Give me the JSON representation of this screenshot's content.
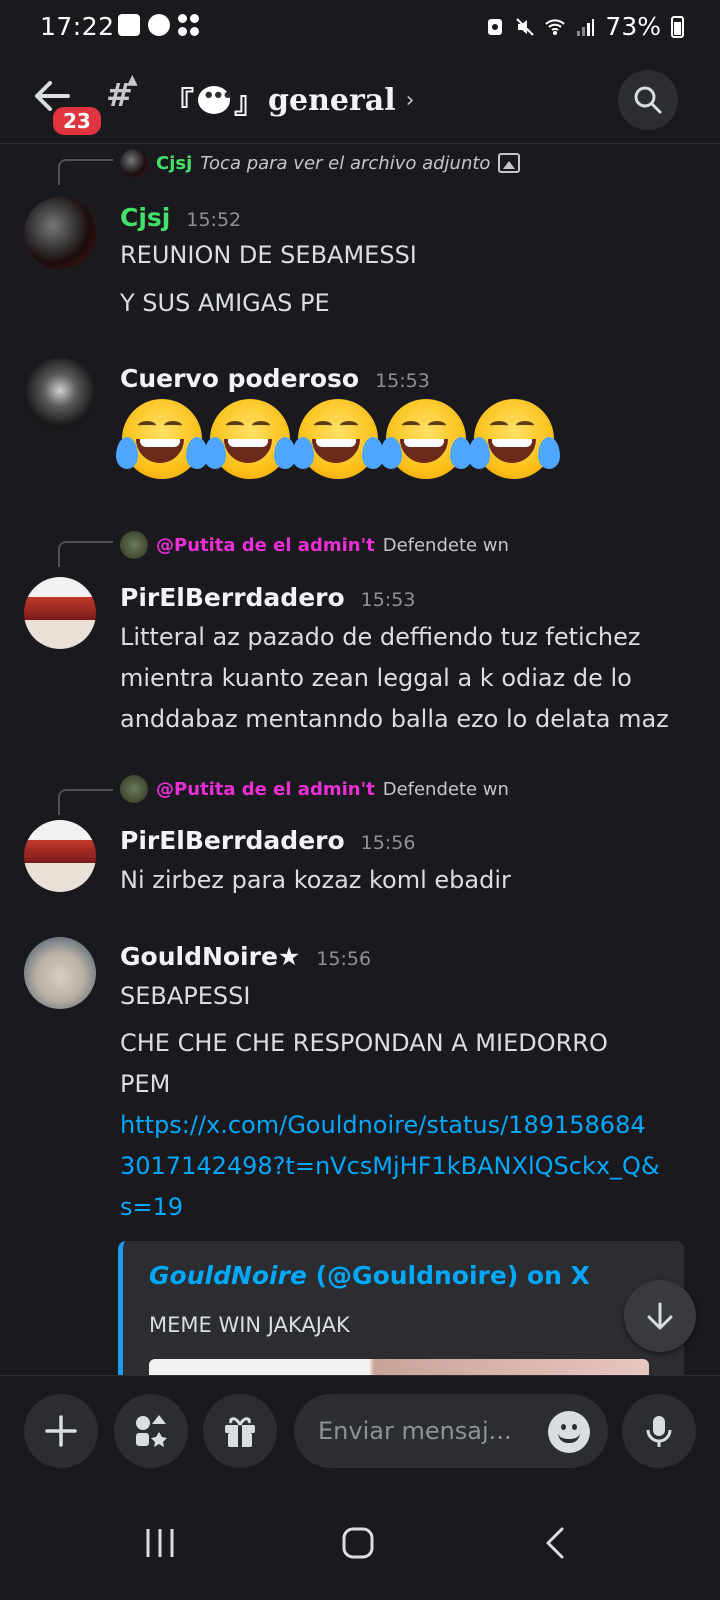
{
  "status_bar": {
    "time": "17:22",
    "battery": "73%"
  },
  "header": {
    "back_badge": "23",
    "channel_name": "general",
    "title_left_bracket": "『",
    "title_right_bracket": "』",
    "chevron": "›"
  },
  "messages": [
    {
      "reply": {
        "author": "Cjsj",
        "text": "Toca para ver el archivo adjunto",
        "author_color": "#3ba55d"
      },
      "author": "Cjsj",
      "author_color": "#43e06a",
      "time": "15:52",
      "lines": [
        "REUNION DE SEBAMESSI",
        "Y SUS AMIGAS PE"
      ]
    },
    {
      "author": "Cuervo poderoso",
      "author_color": "#f2f3f5",
      "time": "15:53",
      "emoji": [
        "face-with-tears-of-joy",
        "face-with-tears-of-joy",
        "face-with-tears-of-joy",
        "face-with-tears-of-joy",
        "face-with-tears-of-joy"
      ]
    },
    {
      "reply": {
        "author": "@Putita de el admin't",
        "text": "Defendete wn",
        "author_color": "#eb2fd6"
      },
      "author": "PirElBerrdadero",
      "author_color": "#f2f3f5",
      "time": "15:53",
      "lines": [
        "Litteral az pazado de deffiendo tuz fetichez",
        "mientra kuanto zean leggal   a k odiaz de lo",
        "anddabaz mentanndo balla ezo lo delata maz"
      ]
    },
    {
      "reply": {
        "author": "@Putita de el admin't",
        "text": "Defendete wn",
        "author_color": "#eb2fd6"
      },
      "author": "PirElBerrdadero",
      "author_color": "#f2f3f5",
      "time": "15:56",
      "lines": [
        "Ni zirbez para kozaz koml ebadir"
      ]
    },
    {
      "author": "GouldNoire★",
      "author_color": "#f2f3f5",
      "time": "15:56",
      "lines": [
        "SEBAPESSI",
        "CHE CHE CHE RESPONDAN A MIEDORRO",
        "PEM"
      ],
      "link_lines": [
        "https://x.com/Gouldnoire/status/189158684",
        "3017142498?t=nVcsMjHF1kBANXlQSckx_Q&",
        "s=19"
      ],
      "embed": {
        "title_name": "GouldNoire",
        "title_rest": " (@Gouldnoire) on X",
        "text": "MEME WIN JAKAJAK"
      }
    }
  ],
  "composer": {
    "placeholder": "Enviar mensaj..."
  },
  "colors": {
    "background": "#1a1a1e",
    "link": "#00a8fc",
    "badge": "#e0343e"
  }
}
